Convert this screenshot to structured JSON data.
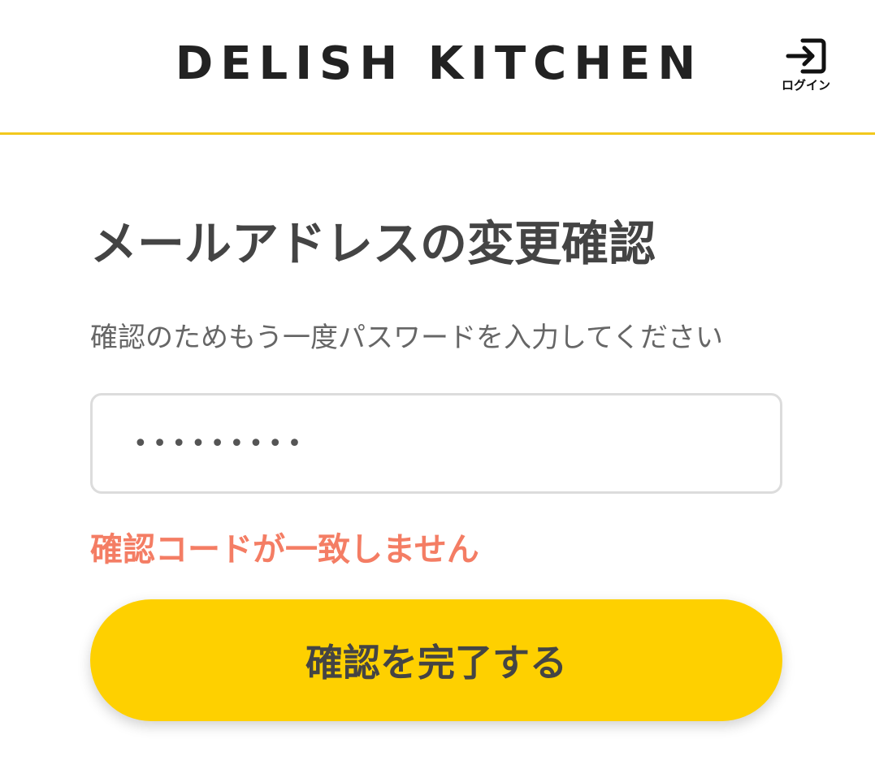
{
  "header": {
    "logo_text": "DELISH KITCHEN",
    "login_label": "ログイン",
    "login_icon": "login-icon",
    "accent_color": "#f2c81d"
  },
  "main": {
    "title": "メールアドレスの変更確認",
    "description": "確認のためもう一度パスワードを入力してください",
    "password_value": "•••••••••",
    "error_message": "確認コードが一致しません",
    "error_color": "#f47d64",
    "submit_label": "確認を完了する",
    "button_color": "#fed000"
  }
}
